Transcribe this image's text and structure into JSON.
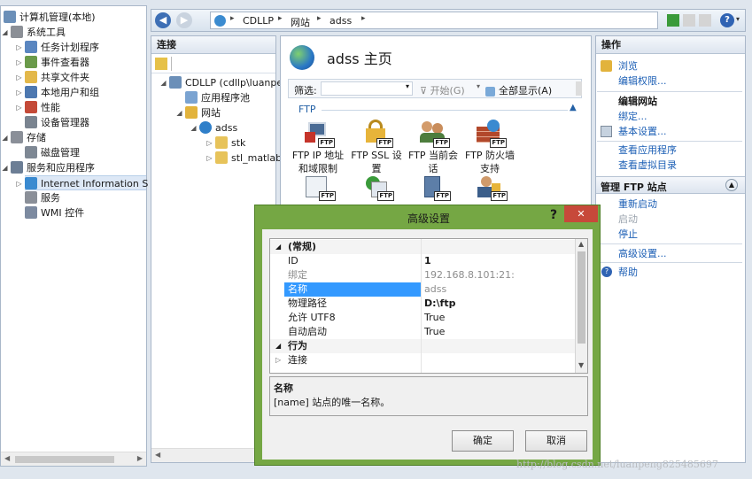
{
  "colors": {
    "dialog_border": "#6fa43c",
    "accent": "#1c5fb5",
    "close": "#c7493a",
    "selected": "#3399ff"
  },
  "left_tree": {
    "root": "计算机管理(本地)",
    "items": [
      {
        "label": "系统工具",
        "icon": "tools-icon"
      },
      {
        "label": "任务计划程序",
        "icon": "clock-icon"
      },
      {
        "label": "事件查看器",
        "icon": "event-viewer-icon"
      },
      {
        "label": "共享文件夹",
        "icon": "shared-folder-icon"
      },
      {
        "label": "本地用户和组",
        "icon": "users-icon"
      },
      {
        "label": "性能",
        "icon": "performance-icon"
      },
      {
        "label": "设备管理器",
        "icon": "device-manager-icon"
      },
      {
        "label": "存储",
        "icon": "storage-icon"
      },
      {
        "label": "磁盘管理",
        "icon": "disk-icon"
      },
      {
        "label": "服务和应用程序",
        "icon": "services-apps-icon"
      },
      {
        "label": "Internet Information S",
        "icon": "iis-icon"
      },
      {
        "label": "服务",
        "icon": "gear-icon"
      },
      {
        "label": "WMI 控件",
        "icon": "wmi-icon"
      }
    ]
  },
  "address": {
    "crumbs": [
      "CDLLP",
      "网站",
      "adss"
    ]
  },
  "connections": {
    "header": "连接",
    "items": [
      {
        "label": "CDLLP (cdllp\\luanpe"
      },
      {
        "label": "应用程序池"
      },
      {
        "label": "网站"
      },
      {
        "label": "adss"
      },
      {
        "label": "stk"
      },
      {
        "label": "stl_matlab"
      }
    ]
  },
  "main": {
    "title": "adss 主页",
    "filter_label": "筛选:",
    "start_label": "开始(G)",
    "show_all_label": "全部显示(A)",
    "group": "FTP",
    "features": [
      {
        "label": "FTP IP 地址和域限制",
        "icon": "ip-restrict-icon"
      },
      {
        "label": "FTP SSL 设置",
        "icon": "lock-icon"
      },
      {
        "label": "FTP 当前会话",
        "icon": "session-icon"
      },
      {
        "label": "FTP 防火墙支持",
        "icon": "firewall-icon"
      }
    ]
  },
  "actions": {
    "header": "操作",
    "browse": "浏览",
    "edit_perms": "编辑权限...",
    "edit_site": "编辑网站",
    "bindings": "绑定...",
    "basic_settings": "基本设置...",
    "view_apps": "查看应用程序",
    "view_vdirs": "查看虚拟目录",
    "manage_ftp": "管理 FTP 站点",
    "restart": "重新启动",
    "start": "启动",
    "stop": "停止",
    "advanced": "高级设置...",
    "help": "帮助"
  },
  "dialog": {
    "title": "高级设置",
    "help_glyph": "?",
    "close_glyph": "✕",
    "group_general": "(常规)",
    "props": [
      {
        "key": "ID",
        "value": "1"
      },
      {
        "key": "绑定",
        "value": "192.168.8.101:21:"
      },
      {
        "key": "名称",
        "value": "adss"
      },
      {
        "key": "物理路径",
        "value": "D:\\ftp"
      },
      {
        "key": "允许 UTF8",
        "value": "True"
      },
      {
        "key": "自动启动",
        "value": "True"
      }
    ],
    "group_behavior": "行为",
    "connect": "连接",
    "desc_title": "名称",
    "desc_text": "[name] 站点的唯一名称。",
    "ok": "确定",
    "cancel": "取消"
  },
  "watermark": "http://blog.csdn.net/luanpeng825485697"
}
